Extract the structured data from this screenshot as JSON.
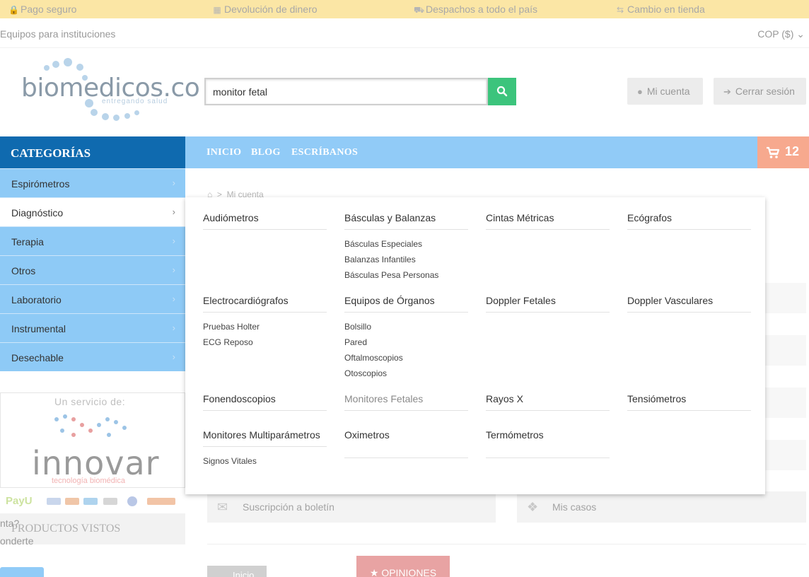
{
  "topbar": {
    "items": [
      {
        "label": "Pago seguro",
        "icon": "lock-icon"
      },
      {
        "label": "Devolución de dinero",
        "icon": "money-icon"
      },
      {
        "label": "Despachos a todo el país",
        "icon": "truck-icon"
      },
      {
        "label": "Cambio en tienda",
        "icon": "exchange-icon"
      }
    ]
  },
  "subbar": {
    "left": "Equipos para instituciones",
    "currency": "COP ($)"
  },
  "header": {
    "logo_text": "biomedicos.co",
    "logo_tagline": "entregando salud",
    "search_value": "monitor fetal",
    "account_label": "Mi cuenta",
    "logout_label": "Cerrar sesión"
  },
  "nav": {
    "categories_title": "CATEGORÍAS",
    "links": [
      "INICIO",
      "BLOG",
      "ESCRÍBANOS"
    ],
    "cart_count": "12"
  },
  "sidebar": {
    "categories": [
      "Espirómetros",
      "Diagnóstico",
      "Terapia",
      "Otros",
      "Laboratorio",
      "Instrumental",
      "Desechable"
    ],
    "active_index": 1,
    "servicio_title": "Un servicio de:",
    "innovar_text": "innovar",
    "innovar_tagline": "tecnología biomédica",
    "payu": "PayU",
    "vistos_title": "PRODUCTOS VISTOS",
    "ghost_1": "nta?",
    "ghost_2": "onderte"
  },
  "main": {
    "breadcrumb_current": "Mi cuenta",
    "boletin_label": "Suscripción a boletín",
    "casos_label": "Mis casos",
    "inicio_button": "Inicio",
    "opiniones_button": "★ OPINIONES"
  },
  "mega_menu": {
    "groups": [
      {
        "title": "Audiómetros",
        "items": []
      },
      {
        "title": "Básculas y Balanzas",
        "items": [
          "Básculas Especiales",
          "Balanzas Infantiles",
          "Básculas Pesa Personas"
        ]
      },
      {
        "title": "Cintas Métricas",
        "items": []
      },
      {
        "title": "Ecógrafos",
        "items": []
      },
      {
        "title": "Electrocardiógrafos",
        "items": [
          "Pruebas Holter",
          "ECG Reposo"
        ]
      },
      {
        "title": "Equipos de Órganos",
        "items": [
          "Bolsillo",
          "Pared",
          "Oftalmoscopios",
          "Otoscopios"
        ]
      },
      {
        "title": "Doppler Fetales",
        "items": []
      },
      {
        "title": "Doppler Vasculares",
        "items": []
      },
      {
        "title": "Fonendoscopios",
        "items": []
      },
      {
        "title": "Monitores Fetales",
        "items": []
      },
      {
        "title": "Rayos X",
        "items": []
      },
      {
        "title": "Tensiómetros",
        "items": []
      },
      {
        "title": "Monitores Multiparámetros",
        "items": [
          "Signos Vitales"
        ]
      },
      {
        "title": "Oximetros",
        "items": []
      },
      {
        "title": "Termómetros",
        "items": []
      }
    ]
  },
  "colors": {
    "topbar": "#fbe6a5",
    "category_header": "#0f6aaf",
    "nav_blue": "#91cbf7",
    "cart": "#f7a98e",
    "search_button": "#3cc47c"
  }
}
